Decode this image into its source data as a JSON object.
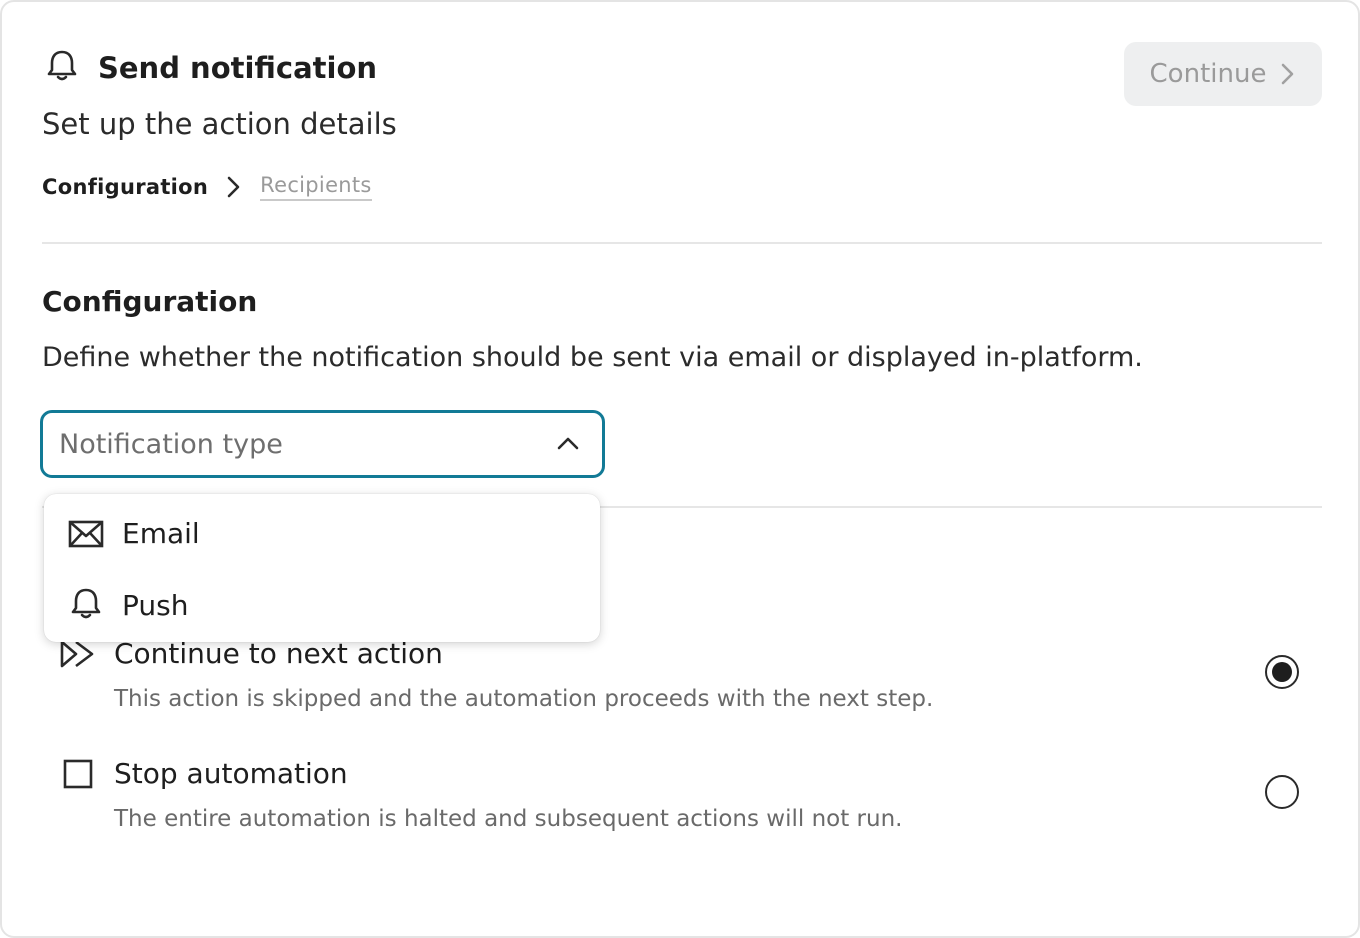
{
  "header": {
    "title": "Send notification",
    "subtitle": "Set up the action details",
    "icon": "bell-icon",
    "continue_label": "Continue"
  },
  "breadcrumb": {
    "active": "Configuration",
    "inactive": "Recipients"
  },
  "configuration": {
    "title": "Configuration",
    "description": "Define whether the notification should be sent via email or displayed in-platform.",
    "select": {
      "placeholder": "Notification type",
      "expanded": true,
      "options": [
        {
          "label": "Email",
          "icon": "envelope-icon"
        },
        {
          "label": "Push",
          "icon": "bell-icon"
        }
      ]
    }
  },
  "on_error": {
    "options": [
      {
        "title": "Continue to next action",
        "description": "This action is skipped and the automation proceeds with the next step.",
        "icon": "fast-forward-icon",
        "selected": true
      },
      {
        "title": "Stop automation",
        "description": "The entire automation is halted and subsequent actions will not run.",
        "icon": "stop-square-icon",
        "selected": false
      }
    ]
  },
  "colors": {
    "focus_border": "#127a96",
    "disabled_button_bg": "#eeeff0",
    "disabled_text": "#9a9a9a"
  }
}
